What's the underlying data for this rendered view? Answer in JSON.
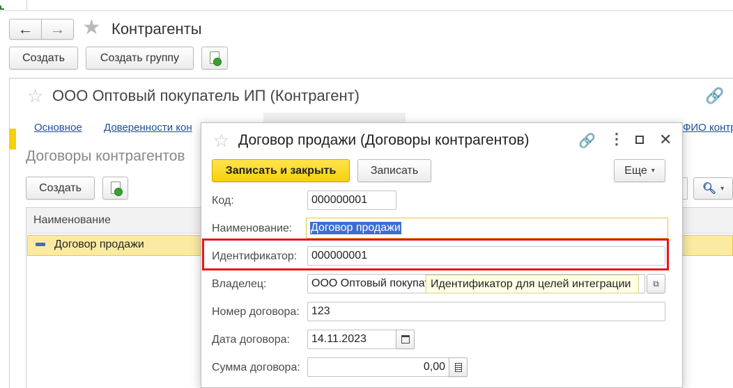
{
  "main": {
    "back": "←",
    "forward": "→",
    "title": "Контрагенты",
    "create": "Создать",
    "create_group": "Создать группу"
  },
  "partner": {
    "title": "ООО Оптовый покупатель ИП (Контрагент)",
    "tabs": [
      "Основное",
      "Доверенности кон",
      "ФИО контр"
    ],
    "section_title": "Договоры контрагентов",
    "create": "Создать",
    "table_header": "Наименование",
    "row_text": "Договор продажи",
    "search_icon": "search-icon"
  },
  "dialog": {
    "title": "Договор продажи (Договоры контрагентов)",
    "save_close": "Записать и закрыть",
    "save": "Записать",
    "more": "Еще",
    "fields": {
      "code_label": "Код:",
      "code_value": "000000001",
      "name_label": "Наименование:",
      "name_value": "Договор продажи",
      "ident_label": "Идентификатор:",
      "ident_value": "000000001",
      "owner_label": "Владелец:",
      "owner_value": "ООО Оптовый покупатель ИП",
      "number_label": "Номер договора:",
      "number_value": "123",
      "date_label": "Дата договора:",
      "date_value": "14.11.2023",
      "sum_label": "Сумма договора:",
      "sum_value": "0,00"
    },
    "tooltip": "Идентификатор для целей интеграции"
  },
  "colors": {
    "highlight_red": "#e8141b",
    "accent_yellow": "#f5d10a",
    "link_blue": "#1c4e9c"
  }
}
